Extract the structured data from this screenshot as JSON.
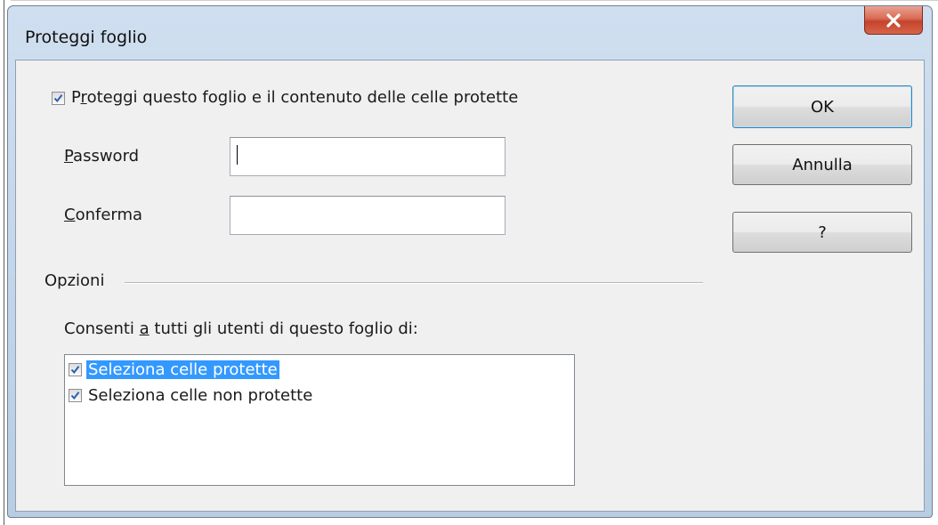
{
  "window": {
    "title": "Proteggi foglio"
  },
  "protect_checkbox": {
    "checked": true,
    "label_pre": "P",
    "label_ul": "r",
    "label_post": "oteggi questo foglio e il contenuto delle celle protette"
  },
  "password": {
    "label_ul": "P",
    "label_post": "assword",
    "value": ""
  },
  "confirm": {
    "label_ul": "C",
    "label_post": "onferma",
    "value": ""
  },
  "buttons": {
    "ok": "OK",
    "cancel": "Annulla",
    "help": "?"
  },
  "options": {
    "group_title": "Opzioni",
    "allow_pre": "Consenti ",
    "allow_ul": "a",
    "allow_post": " tutti gli utenti di questo foglio di:",
    "items": [
      {
        "label": "Seleziona celle protette",
        "checked": true,
        "selected": true
      },
      {
        "label": "Seleziona celle non protette",
        "checked": true,
        "selected": false
      }
    ]
  },
  "colors": {
    "selection": "#3399ff",
    "close_button": "#c4432c",
    "dialog_bg": "#f0f0f0"
  }
}
